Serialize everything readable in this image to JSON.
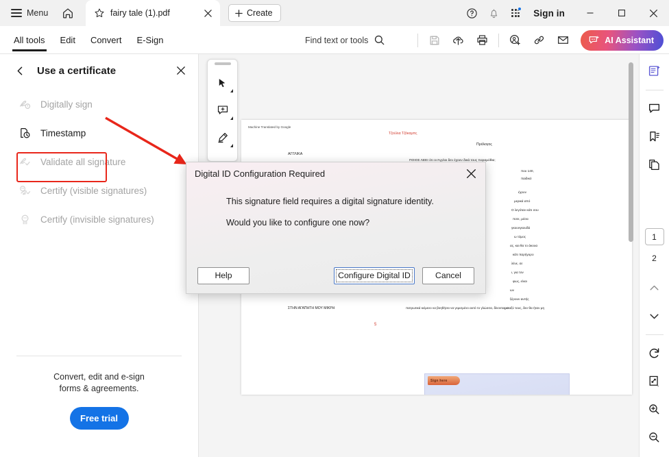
{
  "window": {
    "menu_label": "Menu",
    "home_icon": "home-icon",
    "tab_title": "fairy tale (1).pdf",
    "tab_star_icon": "star-icon",
    "tab_close_icon": "close-icon",
    "create_label": "Create",
    "help_icon": "help-circle-icon",
    "bell_icon": "bell-icon",
    "apps_icon": "apps-grid-icon",
    "signin_label": "Sign in",
    "minimize_icon": "minimize-icon",
    "maximize_icon": "maximize-icon",
    "close_icon": "window-close-icon"
  },
  "toolbar": {
    "tabs": [
      {
        "label": "All tools",
        "active": true
      },
      {
        "label": "Edit",
        "active": false
      },
      {
        "label": "Convert",
        "active": false
      },
      {
        "label": "E-Sign",
        "active": false
      }
    ],
    "find_label": "Find text or tools",
    "find_icon": "search-icon",
    "save_icon": "save-floppy-icon",
    "cloud_icon": "cloud-upload-icon",
    "print_icon": "print-icon",
    "request_signature_icon": "request-esignature-icon",
    "link_icon": "link-icon",
    "mail_icon": "mail-icon",
    "ai_label": "AI Assistant",
    "ai_icon": "ai-sparkle-icon",
    "ai_gradient_start": "#ec5b4a",
    "ai_gradient_end": "#4b4fd6"
  },
  "left_panel": {
    "back_icon": "chevron-left-icon",
    "title": "Use a certificate",
    "close_icon": "close-icon",
    "items": [
      {
        "label": "Digitally sign",
        "icon": "digital-sign-icon",
        "disabled": true,
        "highlighted": true
      },
      {
        "label": "Timestamp",
        "icon": "timestamp-icon",
        "disabled": false,
        "highlighted": false
      },
      {
        "label": "Validate all signature",
        "icon": "validate-signature-icon",
        "disabled": true,
        "highlighted": false
      },
      {
        "label": "Certify (visible signatures)",
        "icon": "certify-visible-icon",
        "disabled": true,
        "highlighted": false
      },
      {
        "label": "Certify (invisible signatures)",
        "icon": "certify-invisible-icon",
        "disabled": true,
        "highlighted": false
      }
    ],
    "promo_line1": "Convert, edit and e-sign",
    "promo_line2": "forms & agreements.",
    "free_trial_label": "Free trial",
    "free_trial_color": "#1473e6",
    "annotation_color": "#e8261a"
  },
  "dialog": {
    "title": "Digital ID Configuration Required",
    "close_icon": "close-icon",
    "message_line1": "This signature field requires a digital signature identity.",
    "message_line2": "Would you like to configure one now?",
    "buttons": [
      {
        "label": "Help",
        "default": false
      },
      {
        "label": "Configure Digital ID",
        "default": true
      },
      {
        "label": "Cancel",
        "default": false
      }
    ]
  },
  "float_tools": {
    "drag_handle": "drag-handle",
    "items": [
      {
        "icon": "select-cursor-icon",
        "label": "Select"
      },
      {
        "icon": "add-comment-icon",
        "label": "Add comment"
      },
      {
        "icon": "highlighter-icon",
        "label": "Highlight"
      }
    ]
  },
  "right_rail": {
    "top_items": [
      {
        "icon": "ai-document-icon",
        "label": "Edit with AI"
      },
      {
        "icon": "comment-bubble-icon",
        "label": "Comments"
      },
      {
        "icon": "bookmark-icon",
        "label": "Bookmarks"
      },
      {
        "icon": "pages-icon",
        "label": "Page thumbnails"
      }
    ],
    "pages": [
      {
        "number": "1",
        "current": true
      },
      {
        "number": "2",
        "current": false
      }
    ],
    "nav": [
      {
        "icon": "chevron-up-icon",
        "label": "Previous page"
      },
      {
        "icon": "chevron-down-icon",
        "label": "Next page"
      }
    ],
    "bottom_items": [
      {
        "icon": "rotate-icon",
        "label": "Rotate"
      },
      {
        "icon": "fit-page-icon",
        "label": "Fit page"
      },
      {
        "icon": "zoom-in-icon",
        "label": "Zoom in"
      },
      {
        "icon": "zoom-out-icon",
        "label": "Zoom out"
      }
    ]
  },
  "document": {
    "header_note": "Machine Translated by Google",
    "title_red": "Τζούλια Τζόκαμπς",
    "heading_right": "Πρόλογος",
    "heading_left": "ΑΓΓΛΙΚΑ",
    "lines": [
      "ΠΟΙΟΣ ΛΕΕΙ ότι οι Άγγλοι δεν έχουν δικά τους παραμύθια;",
      "που 140,",
      "παιδικό",
      "έχουν",
      "μερικά από",
      "Ο λεγόταν κάτι σου",
      "ποτε, μέσα",
      "γκουνγκουδά",
      "ω τόμος",
      "ας, και θα το άκουα",
      "κάτι παρήγορο",
      "λένε, σε",
      "ι, για τον",
      "φως, είναι",
      "ων",
      "ξέρουν αυτής",
      "μεταξύ τους, δεν θα ήταν μη",
      "ρα, δίνοντας ο"
    ],
    "footer_left": "ΣΤΗΝ ΑΓΑΠΗΤΗ ΜΟΥ ΜΙΚΡΗ",
    "footer_right": "πατρωτικά κείμενο να βοηθήσει να γεμισμένο αυτό το γλώσσα, δίνοντας ο",
    "page_number": "5",
    "signature_field_label": "Sign here",
    "signature_field_color": "#dfe4f7"
  }
}
